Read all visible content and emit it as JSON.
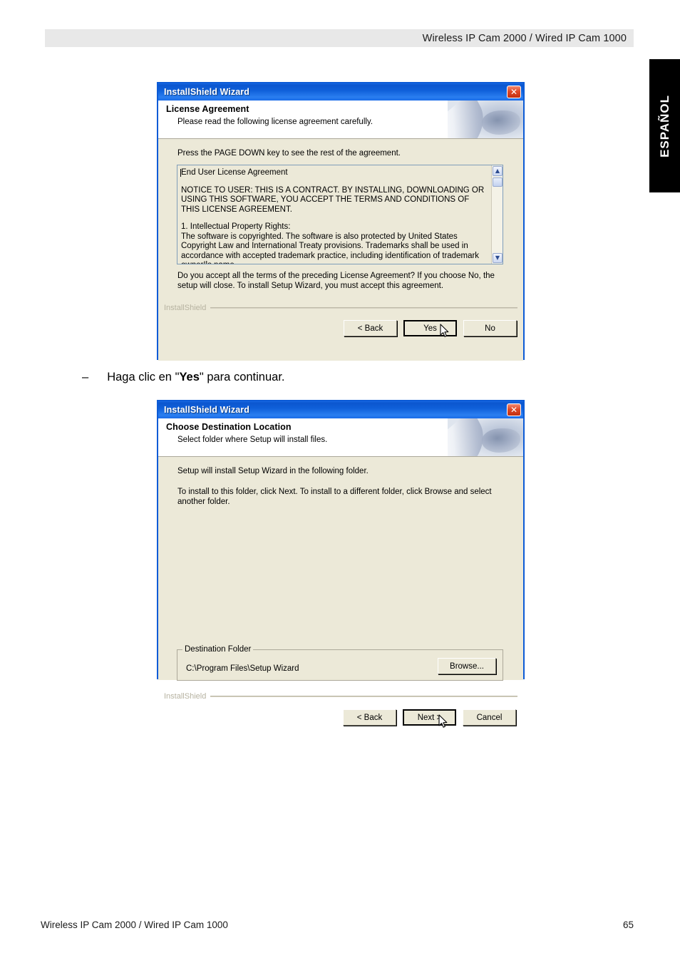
{
  "page": {
    "header_text": "Wireless IP Cam 2000 / Wired IP Cam 1000",
    "language_tab": "ESPAÑOL",
    "footer_left": "Wireless IP Cam 2000 / Wired IP Cam 1000",
    "footer_page_number": "65"
  },
  "step": {
    "dash": "–",
    "prefix": "Haga clic en \"",
    "emphasis": "Yes",
    "suffix": "\" para continuar."
  },
  "dialog_license": {
    "title": "InstallShield Wizard",
    "close_glyph": "✕",
    "banner_heading": "License Agreement",
    "banner_subtext": "Please read the following license agreement carefully.",
    "instruction": "Press the PAGE DOWN key to see the rest of the agreement.",
    "license_paragraphs": [
      "End User License Agreement",
      "NOTICE TO USER:  THIS IS A CONTRACT.  BY INSTALLING, DOWNLOADING OR USING THIS SOFTWARE, YOU ACCEPT THE TERMS AND CONDITIONS OF THIS LICENSE AGREEMENT.",
      "1.  Intellectual Property Rights:\nThe software is copyrighted.  The software is also protected by United States Copyright Law and International Treaty provisions.  Trademarks shall be used in accordance with accepted trademark practice, including identification of trademark owner!ls name."
    ],
    "scroll_up_glyph": "▲",
    "scroll_down_glyph": "▼",
    "question": "Do you accept all the terms of the preceding License Agreement?  If you choose No,  the setup will close.  To install Setup Wizard, you must accept this agreement.",
    "brandmark": "InstallShield",
    "buttons": {
      "back": "< Back",
      "yes": "Yes",
      "no": "No"
    }
  },
  "dialog_destination": {
    "title": "InstallShield Wizard",
    "close_glyph": "✕",
    "banner_heading": "Choose Destination Location",
    "banner_subtext": "Select folder where Setup will install files.",
    "line1": "Setup will install Setup Wizard in the following folder.",
    "line2": "To install to this folder, click Next. To install to a different folder, click Browse and select another folder.",
    "group_label": "Destination Folder",
    "folder_path": "C:\\Program Files\\Setup Wizard",
    "browse_label": "Browse...",
    "brandmark": "InstallShield",
    "buttons": {
      "back": "< Back",
      "next": "Next >",
      "cancel": "Cancel"
    }
  },
  "colors": {
    "titlebar_blue": "#0b56cf",
    "dialog_face": "#ece9d8",
    "header_band": "#e8e8e8",
    "close_red": "#c22f10"
  }
}
